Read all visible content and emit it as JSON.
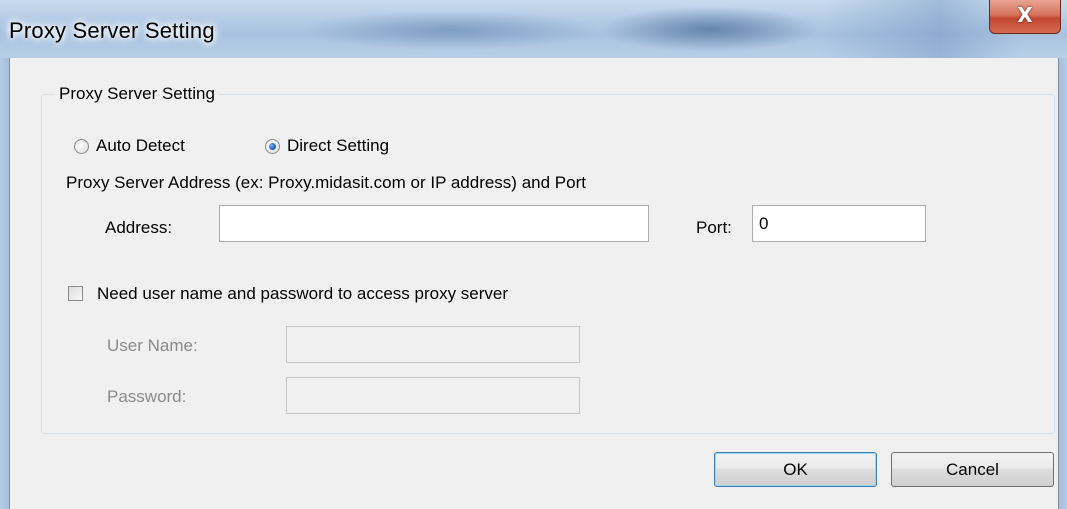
{
  "window": {
    "title": "Proxy Server Setting",
    "close_glyph": "X"
  },
  "group": {
    "label": "Proxy Server Setting"
  },
  "mode": {
    "options": [
      {
        "label": "Auto Detect",
        "selected": false
      },
      {
        "label": "Direct Setting",
        "selected": true
      }
    ]
  },
  "address_hint": "Proxy Server Address (ex: Proxy.midasit.com or IP address) and Port",
  "address": {
    "label": "Address:",
    "value": ""
  },
  "port": {
    "label": "Port:",
    "value": "0"
  },
  "auth": {
    "checkbox_label": "Need user name and password to access proxy server",
    "checked": false,
    "username_label": "User Name:",
    "username_value": "",
    "password_label": "Password:",
    "password_value": ""
  },
  "buttons": {
    "ok": "OK",
    "cancel": "Cancel"
  },
  "icons": {
    "close": "close-icon",
    "radio": "radio-button",
    "checkbox": "checkbox"
  }
}
